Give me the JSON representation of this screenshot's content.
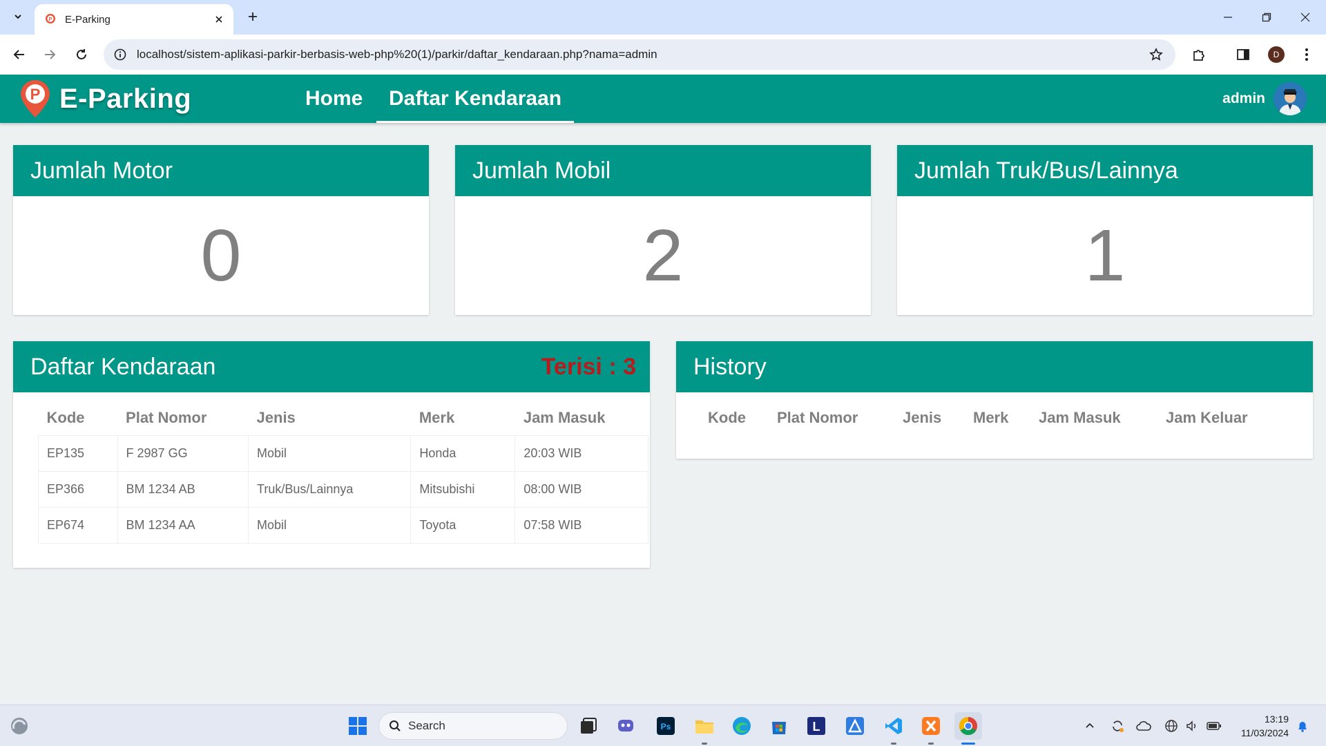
{
  "browser": {
    "tab_title": "E-Parking",
    "url": "localhost/sistem-aplikasi-parkir-berbasis-web-php%20(1)/parkir/daftar_kendaraan.php?nama=admin",
    "profile_initial": "D"
  },
  "app": {
    "brand": "E-Parking",
    "brand_letter": "P",
    "nav": [
      {
        "label": "Home",
        "active": false
      },
      {
        "label": "Daftar Kendaraan",
        "active": true
      }
    ],
    "user": "admin"
  },
  "stats": [
    {
      "title": "Jumlah Motor",
      "value": "0"
    },
    {
      "title": "Jumlah Mobil",
      "value": "2"
    },
    {
      "title": "Jumlah Truk/Bus/Lainnya",
      "value": "1"
    }
  ],
  "vehicles": {
    "title": "Daftar Kendaraan",
    "occupied": "Terisi : 3",
    "columns": [
      "Kode",
      "Plat Nomor",
      "Jenis",
      "Merk",
      "Jam Masuk"
    ],
    "rows": [
      [
        "EP135",
        "F 2987 GG",
        "Mobil",
        "Honda",
        "20:03 WIB"
      ],
      [
        "EP366",
        "BM 1234 AB",
        "Truk/Bus/Lainnya",
        "Mitsubishi",
        "08:00 WIB"
      ],
      [
        "EP674",
        "BM 1234 AA",
        "Mobil",
        "Toyota",
        "07:58 WIB"
      ]
    ]
  },
  "history": {
    "title": "History",
    "columns": [
      "Kode",
      "Plat Nomor",
      "Jenis",
      "Merk",
      "Jam Masuk",
      "Jam Keluar"
    ],
    "rows": []
  },
  "taskbar": {
    "search_placeholder": "Search",
    "time": "13:19",
    "date": "11/03/2024"
  },
  "colors": {
    "primary": "#009688",
    "accent_red": "#b71c1c",
    "page_bg": "#eef1f2"
  }
}
